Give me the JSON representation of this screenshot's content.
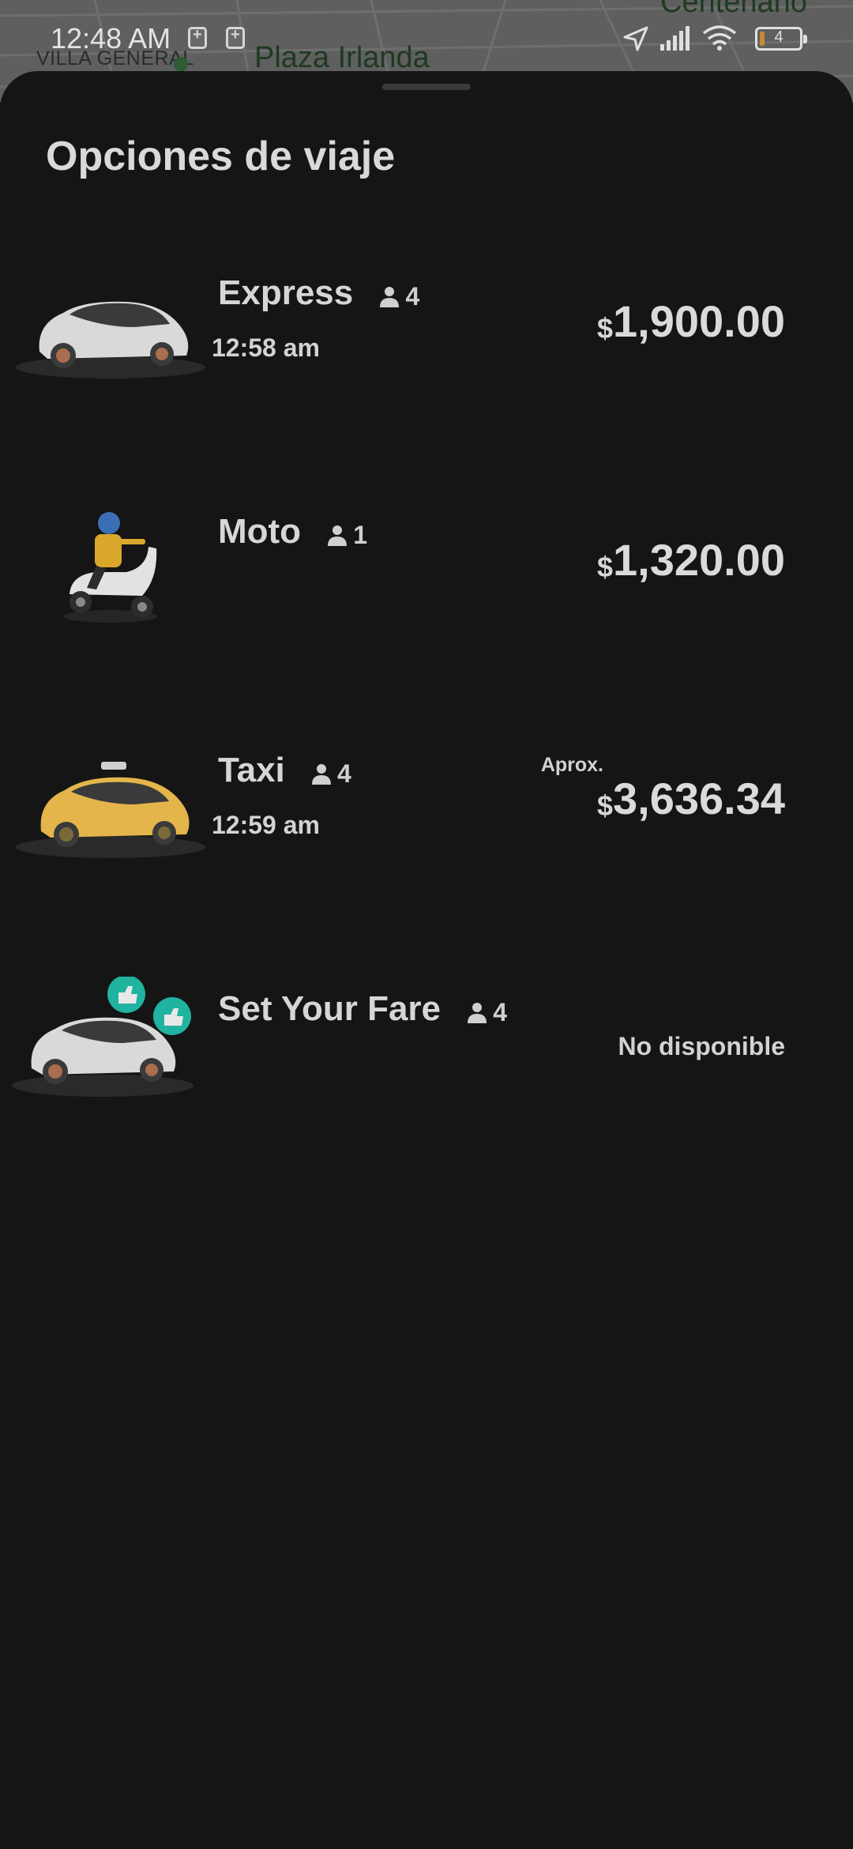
{
  "status_bar": {
    "time": "12:48 AM",
    "battery_level": "4"
  },
  "map": {
    "labels": [
      "VILLA GENERAL",
      "Plaza Irlanda",
      "Centenario"
    ]
  },
  "sheet": {
    "title": "Opciones de viaje"
  },
  "options": [
    {
      "name": "Express",
      "capacity": "4",
      "time": "12:58 am",
      "currency": "$",
      "price": "1,900.00",
      "image": "white-car-icon"
    },
    {
      "name": "Moto",
      "capacity": "1",
      "currency": "$",
      "price": "1,320.00",
      "image": "scooter-rider-icon"
    },
    {
      "name": "Taxi",
      "capacity": "4",
      "time": "12:59 am",
      "price_prefix": "Aprox.",
      "currency": "$",
      "price": "3,636.34",
      "image": "yellow-taxi-icon"
    },
    {
      "name": "Set Your Fare",
      "capacity": "4",
      "status": "No disponible",
      "image": "car-with-thumbs-up-icon"
    }
  ],
  "colors": {
    "background": "#151515",
    "taxi": "#e3b54a",
    "thumbs_badge": "#1fb3a0"
  }
}
